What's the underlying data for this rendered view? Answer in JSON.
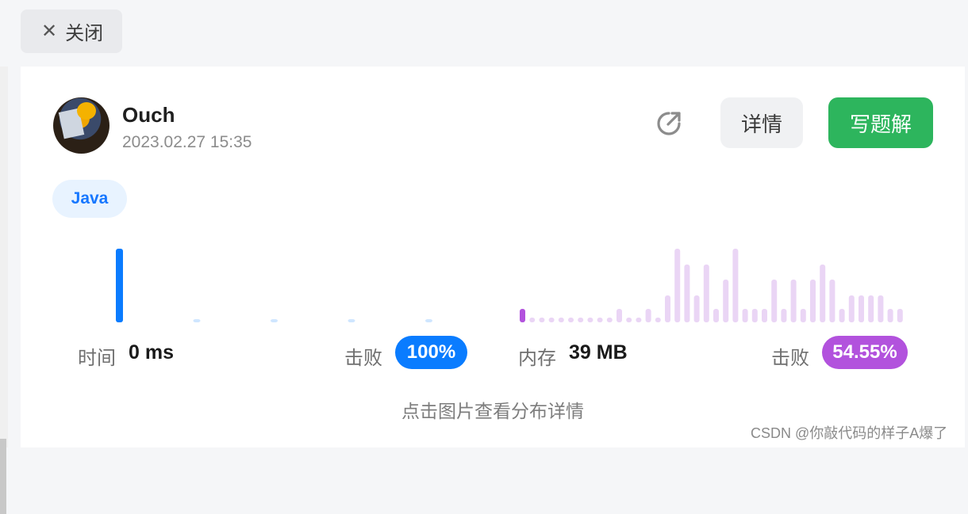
{
  "toolbar": {
    "close_label": "关闭"
  },
  "submission": {
    "user_name": "Ouch",
    "date": "2023.02.27 15:35",
    "detail_label": "详情",
    "write_solution_label": "写题解",
    "language": "Java"
  },
  "runtime": {
    "label": "时间",
    "value": "0 ms",
    "beat_label": "击败",
    "beat_percent": "100%",
    "color": "#0a7cff"
  },
  "memory": {
    "label": "内存",
    "value": "39 MB",
    "beat_label": "击败",
    "beat_percent": "54.55%",
    "color": "#b252dd"
  },
  "hint": "点击图片查看分布详情",
  "watermark": "CSDN @你敲代码的样子A爆了",
  "chart_data": [
    {
      "type": "bar",
      "name": "runtime-distribution",
      "values": [
        100,
        4,
        4,
        4,
        4
      ],
      "highlight_index": 0,
      "highlight_color": "#0a7cff",
      "color": "#cfe6ff"
    },
    {
      "type": "bar",
      "name": "memory-distribution",
      "values": [
        17,
        6,
        6,
        6,
        6,
        6,
        6,
        6,
        6,
        6,
        17,
        6,
        6,
        17,
        6,
        34,
        93,
        73,
        34,
        73,
        17,
        54,
        93,
        17,
        17,
        17,
        54,
        17,
        54,
        17,
        54,
        73,
        54,
        17,
        34,
        34,
        34,
        34,
        17,
        17
      ],
      "highlight_index": 0,
      "highlight_color": "#b252dd",
      "color": "#ead5f5"
    }
  ]
}
